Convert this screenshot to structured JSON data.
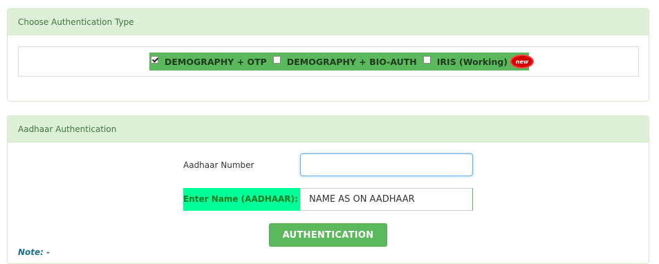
{
  "auth_type_panel": {
    "heading": "Choose Authentication Type",
    "options": [
      {
        "label": "DEMOGRAPHY + OTP",
        "checked": true
      },
      {
        "label": "DEMOGRAPHY + BIO-AUTH",
        "checked": false
      },
      {
        "label": "IRIS (Working)",
        "checked": false
      }
    ],
    "new_badge": "new"
  },
  "aadhaar_panel": {
    "heading": "Aadhaar Authentication",
    "aadhaar_number_label": "Aadhaar Number",
    "aadhaar_number_value": "",
    "name_label": "Enter Name (AADHAAR):",
    "name_value": "NAME AS ON AADHAAR",
    "button_label": "AUTHENTICATION",
    "note": "Note: -"
  },
  "colors": {
    "panel_heading_bg": "#dff0d8",
    "panel_heading_text": "#3c763d",
    "success_green": "#5cb85c",
    "name_label_bg": "#00ff99",
    "badge_red": "#d40000"
  }
}
